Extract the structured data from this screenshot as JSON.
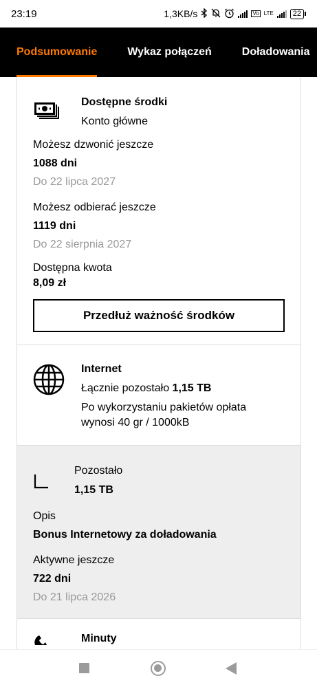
{
  "status_bar": {
    "time": "23:19",
    "speed": "1,3KB/s",
    "battery": "22",
    "network": "LTE"
  },
  "tabs": [
    {
      "label": "Podsumowanie",
      "active": true
    },
    {
      "label": "Wykaz połączeń",
      "active": false
    },
    {
      "label": "Doładowania",
      "active": false
    }
  ],
  "funds": {
    "title": "Dostępne środki",
    "subtitle": "Konto główne",
    "call_label": "Możesz dzwonić jeszcze",
    "call_value": "1088 dni",
    "call_until": "Do 22 lipca 2027",
    "receive_label": "Możesz odbierać jeszcze",
    "receive_value": "1119 dni",
    "receive_until": "Do 22 sierpnia 2027",
    "amount_label": "Dostępna kwota",
    "amount_value": "8,09 zł",
    "extend_button": "Przedłuż ważność środków"
  },
  "internet": {
    "title": "Internet",
    "remaining_prefix": "Łącznie pozostało",
    "remaining_value": "1,15 TB",
    "fee_note_line1": "Po wykorzystaniu pakietów opłata",
    "fee_note_line2": "wynosi 40 gr / 1000kB"
  },
  "bonus": {
    "remaining_label": "Pozostało",
    "remaining_value": "1,15 TB",
    "desc_label": "Opis",
    "desc_value": "Bonus Internetowy za doładowania",
    "active_label": "Aktywne jeszcze",
    "active_value": "722 dni",
    "active_until": "Do 21 lipca 2026"
  },
  "minutes": {
    "title": "Minuty"
  },
  "colors": {
    "accent": "#ff7900",
    "tabbar_bg": "#000000",
    "muted_text": "#999999",
    "grey_card": "#eeeeee"
  }
}
